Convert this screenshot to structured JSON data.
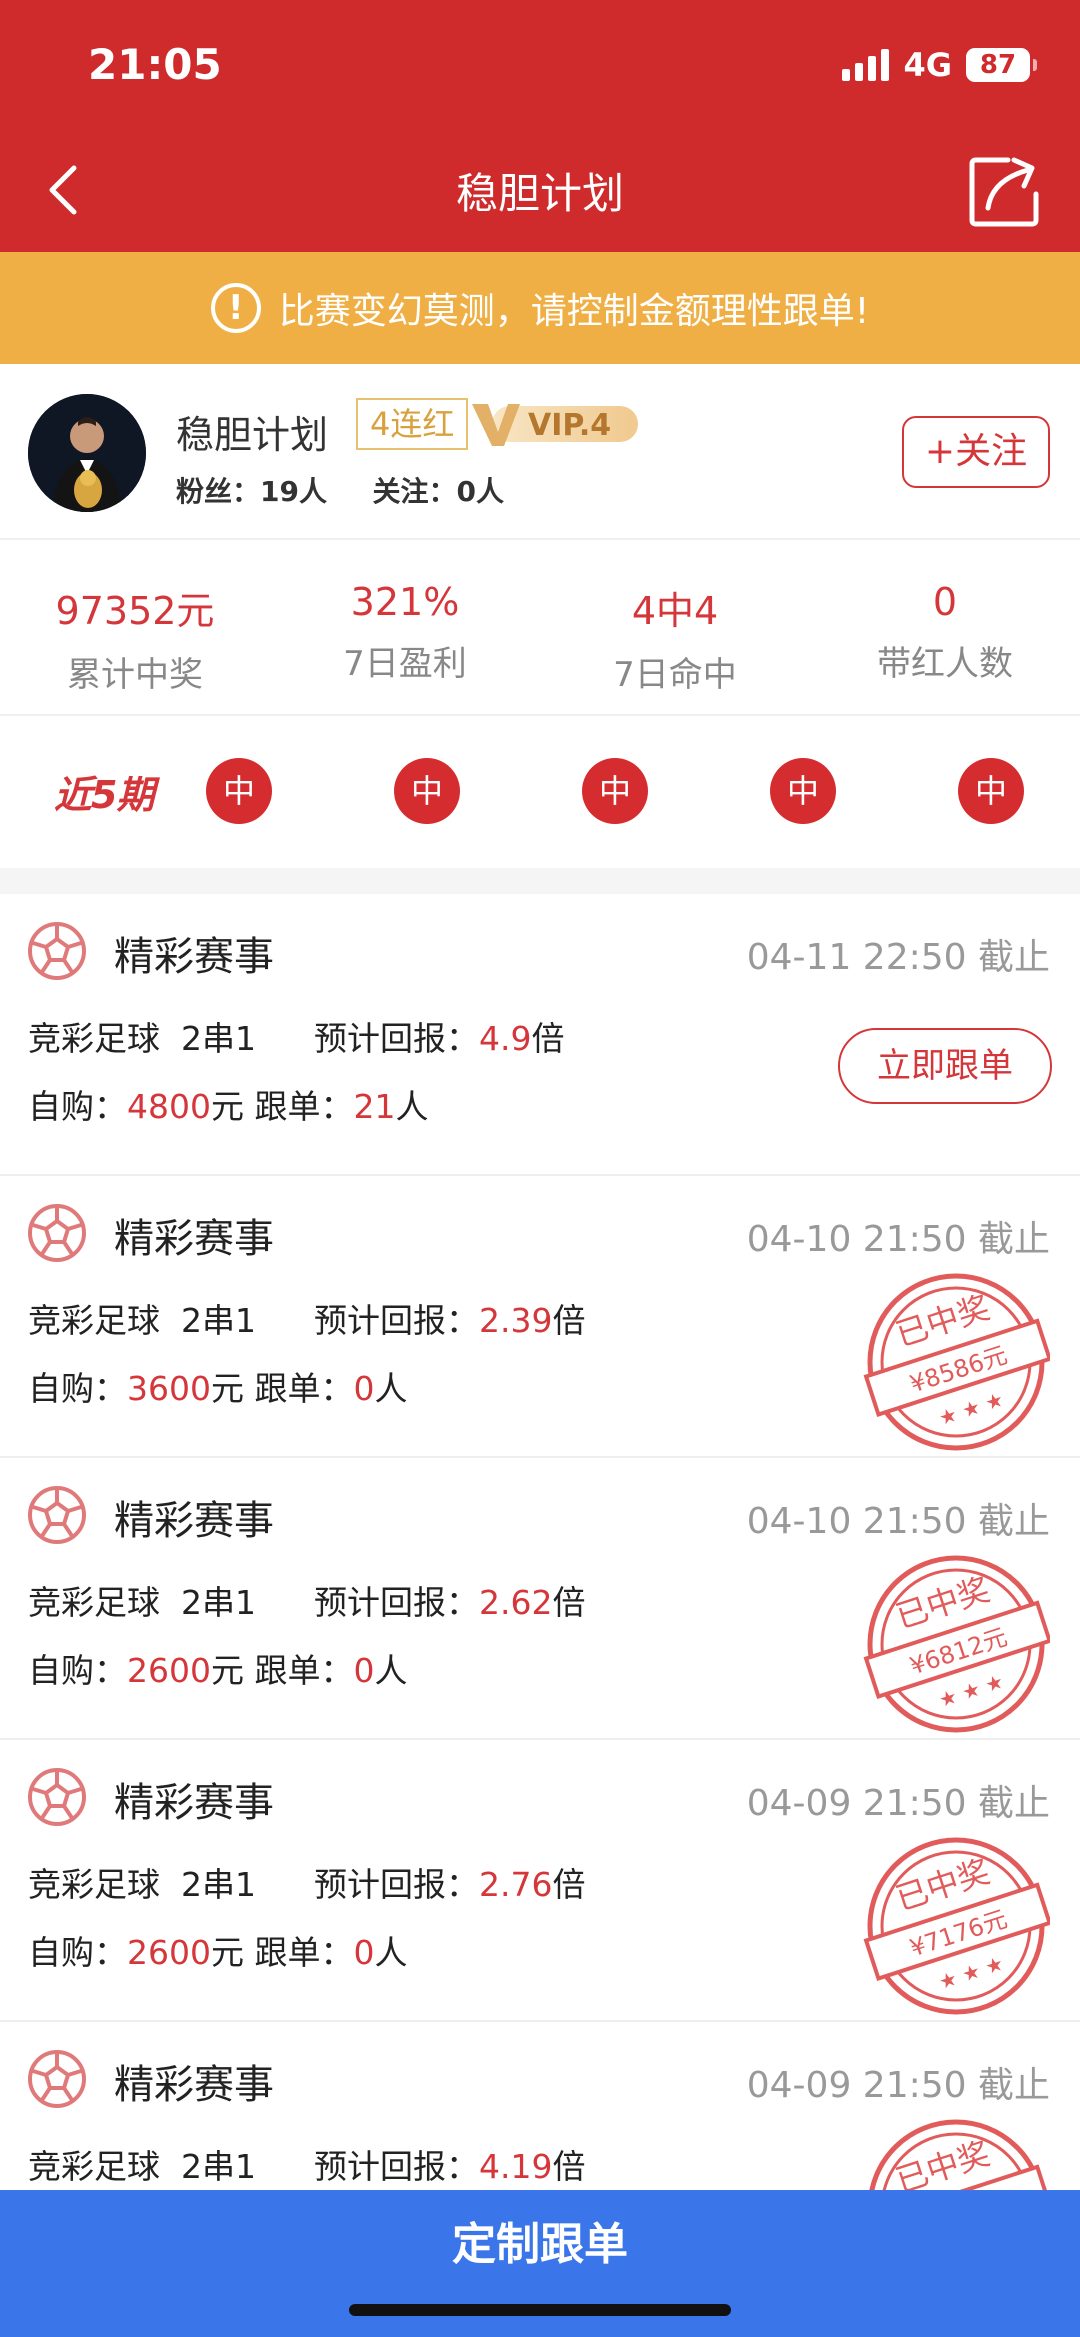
{
  "status_bar": {
    "time": "21:05",
    "network": "4G",
    "battery": "87"
  },
  "nav": {
    "title": "稳胆计划"
  },
  "notice": {
    "text": "比赛变幻莫测，请控制金额理性跟单!"
  },
  "profile": {
    "name": "稳胆计划",
    "streak": "4连红",
    "vip": "VIP.4",
    "fans_label": "粉丝：",
    "fans_value": "19人",
    "following_label": "关注：",
    "following_value": "0人",
    "follow_button": "+关注"
  },
  "stats": [
    {
      "value": "97352元",
      "label": "累计中奖"
    },
    {
      "value": "321%",
      "label": "7日盈利"
    },
    {
      "value": "4中4",
      "label": "7日命中"
    },
    {
      "value": "0",
      "label": "带红人数"
    }
  ],
  "recent": {
    "logo": "近5期",
    "results": [
      "中",
      "中",
      "中",
      "中",
      "中"
    ]
  },
  "cards": [
    {
      "title": "精彩赛事",
      "deadline": "04-11 22:50 截止",
      "game": "竞彩足球",
      "pass_type": "2串1",
      "return_label": "预计回报：",
      "return_value": "4.9",
      "return_unit": "倍",
      "self_label": "自购：",
      "self_value": "4800",
      "self_unit": "元",
      "follow_label": "跟单：",
      "follow_value": "21",
      "follow_unit": "人",
      "action": "立即跟单"
    },
    {
      "title": "精彩赛事",
      "deadline": "04-10 21:50 截止",
      "game": "竞彩足球",
      "pass_type": "2串1",
      "return_label": "预计回报：",
      "return_value": "2.39",
      "return_unit": "倍",
      "self_label": "自购：",
      "self_value": "3600",
      "self_unit": "元",
      "follow_label": "跟单：",
      "follow_value": "0",
      "follow_unit": "人",
      "stamp_title": "已中奖",
      "stamp_amount": "¥8586元"
    },
    {
      "title": "精彩赛事",
      "deadline": "04-10 21:50 截止",
      "game": "竞彩足球",
      "pass_type": "2串1",
      "return_label": "预计回报：",
      "return_value": "2.62",
      "return_unit": "倍",
      "self_label": "自购：",
      "self_value": "2600",
      "self_unit": "元",
      "follow_label": "跟单：",
      "follow_value": "0",
      "follow_unit": "人",
      "stamp_title": "已中奖",
      "stamp_amount": "¥6812元"
    },
    {
      "title": "精彩赛事",
      "deadline": "04-09 21:50 截止",
      "game": "竞彩足球",
      "pass_type": "2串1",
      "return_label": "预计回报：",
      "return_value": "2.76",
      "return_unit": "倍",
      "self_label": "自购：",
      "self_value": "2600",
      "self_unit": "元",
      "follow_label": "跟单：",
      "follow_value": "0",
      "follow_unit": "人",
      "stamp_title": "已中奖",
      "stamp_amount": "¥7176元"
    },
    {
      "title": "精彩赛事",
      "deadline": "04-09 21:50 截止",
      "game": "竞彩足球",
      "pass_type": "2串1",
      "return_label": "预计回报：",
      "return_value": "4.19",
      "return_unit": "倍",
      "stamp_title": "已中奖"
    }
  ],
  "bottom": {
    "label": "定制跟单"
  },
  "colors": {
    "header_red": "#cf2a2c",
    "notice_orange": "#efaf45",
    "accent_red": "#d4363a",
    "bottom_blue": "#3a76ea"
  }
}
